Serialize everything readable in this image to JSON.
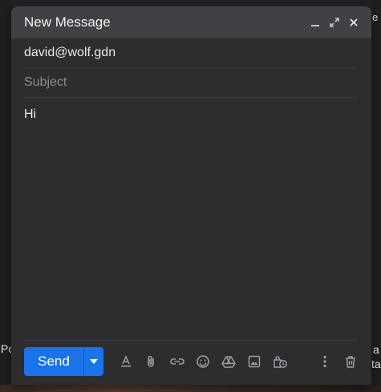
{
  "window": {
    "title": "New Message",
    "to_value": "david@wolf.gdn",
    "subject_placeholder": "Subject",
    "body_text": "Hi"
  },
  "titlebar_icons": [
    "minimize-icon",
    "expand-icon",
    "close-icon"
  ],
  "toolbar": {
    "send_label": "Send",
    "tools": [
      "format-text-icon",
      "attach-icon",
      "link-icon",
      "emoji-icon",
      "drive-icon",
      "photo-icon",
      "confidential-icon"
    ],
    "right_tools": [
      "more-options-icon",
      "trash-icon"
    ]
  },
  "background": {
    "peek_right_top": "e",
    "peek_left": "Po",
    "peek_right_mid_1": "a",
    "peek_right_mid_2": "ta"
  },
  "colors": {
    "accent": "#1a73e8",
    "window_bg": "#2d2d2f",
    "titlebar_bg": "#404144",
    "icon_color": "#9aa0a6"
  }
}
